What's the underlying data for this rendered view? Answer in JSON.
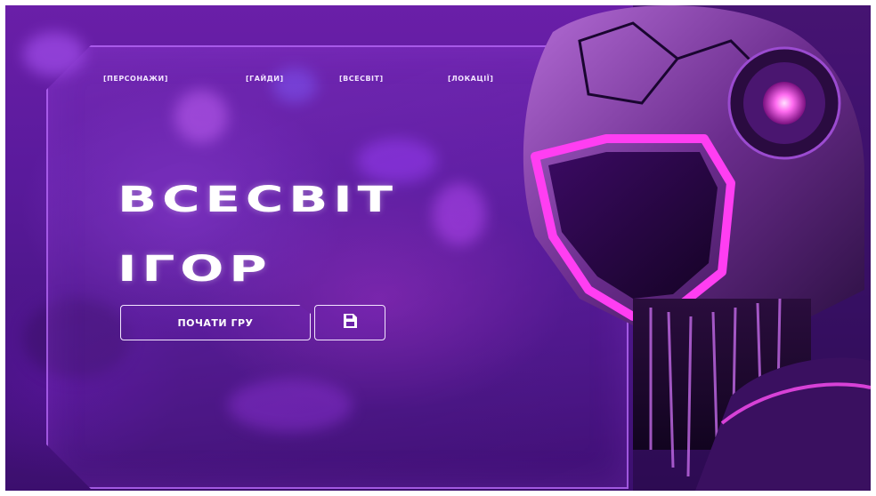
{
  "nav": {
    "items": [
      {
        "label": "[ПЕРСОНАЖИ]"
      },
      {
        "label": "[ГАЙДИ]"
      },
      {
        "label": "[ВСЕСВІТ]"
      },
      {
        "label": "[ЛОКАЦІЇ]"
      }
    ]
  },
  "hero": {
    "title_line1": "ВСЕСВІТ",
    "title_line2": "ІГОР"
  },
  "actions": {
    "start_label": "ПОЧАТИ ГРУ",
    "save_icon": "floppy-disk-icon"
  },
  "colors": {
    "background": "#5a1a9c",
    "accent": "#e23dff",
    "outline": "#f3e6ff"
  }
}
